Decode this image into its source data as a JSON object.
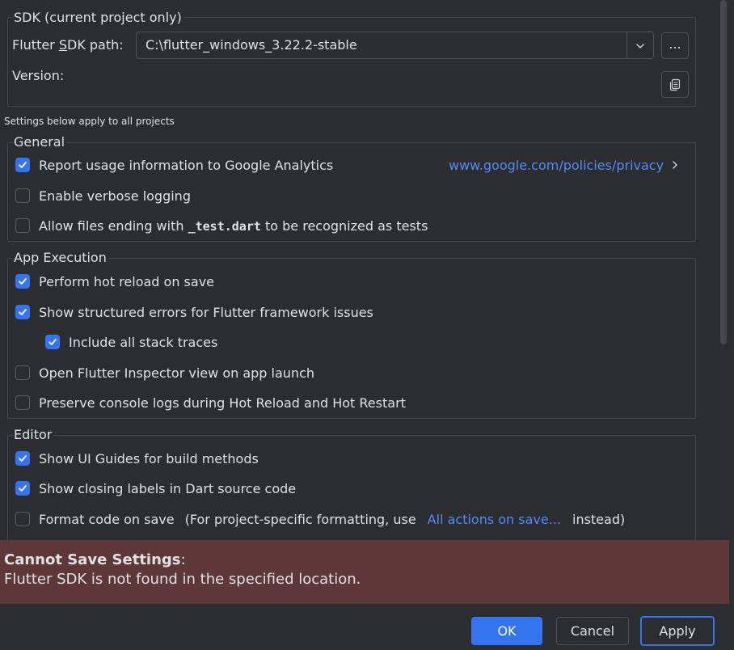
{
  "sdk": {
    "legend": "SDK (current project only)",
    "path_label_pre": "Flutter ",
    "path_label_mnemonic": "S",
    "path_label_post": "DK path:",
    "path_value": "C:\\flutter_windows_3.22.2-stable",
    "browse_label": "...",
    "version_label": "Version:"
  },
  "note": "Settings below apply to all projects",
  "general": {
    "legend": "General",
    "report_usage": {
      "label": "Report usage information to Google Analytics",
      "checked": true
    },
    "privacy_link": "www.google.com/policies/privacy",
    "verbose_logging": {
      "label": "Enable verbose logging",
      "checked": false
    },
    "allow_test_files": {
      "label_pre": "Allow files ending with ",
      "label_code": "_test.dart",
      "label_post": " to be recognized as tests",
      "checked": false
    }
  },
  "app_execution": {
    "legend": "App Execution",
    "hot_reload": {
      "label": "Perform hot reload on save",
      "checked": true
    },
    "structured_errors": {
      "label": "Show structured errors for Flutter framework issues",
      "checked": true
    },
    "stack_traces": {
      "label": "Include all stack traces",
      "checked": true
    },
    "open_inspector": {
      "label": "Open Flutter Inspector view on app launch",
      "checked": false
    },
    "preserve_logs": {
      "label": "Preserve console logs during Hot Reload and Hot Restart",
      "checked": false
    }
  },
  "editor": {
    "legend": "Editor",
    "ui_guides": {
      "label": "Show UI Guides for build methods",
      "checked": true
    },
    "closing_labels": {
      "label": "Show closing labels in Dart source code",
      "checked": true
    },
    "format_on_save": {
      "label": "Format code on save",
      "hint_pre": "(For project-specific formatting, use",
      "hint_link": "All actions on save...",
      "hint_post": "instead)",
      "checked": false
    }
  },
  "error": {
    "title": "Cannot Save Settings",
    "colon": ":",
    "message": "Flutter SDK is not found in the specified location."
  },
  "buttons": {
    "ok": "OK",
    "cancel": "Cancel",
    "apply": "Apply"
  },
  "colors": {
    "accent": "#3574f0",
    "error_bg": "#5e3838",
    "link": "#548af7"
  }
}
